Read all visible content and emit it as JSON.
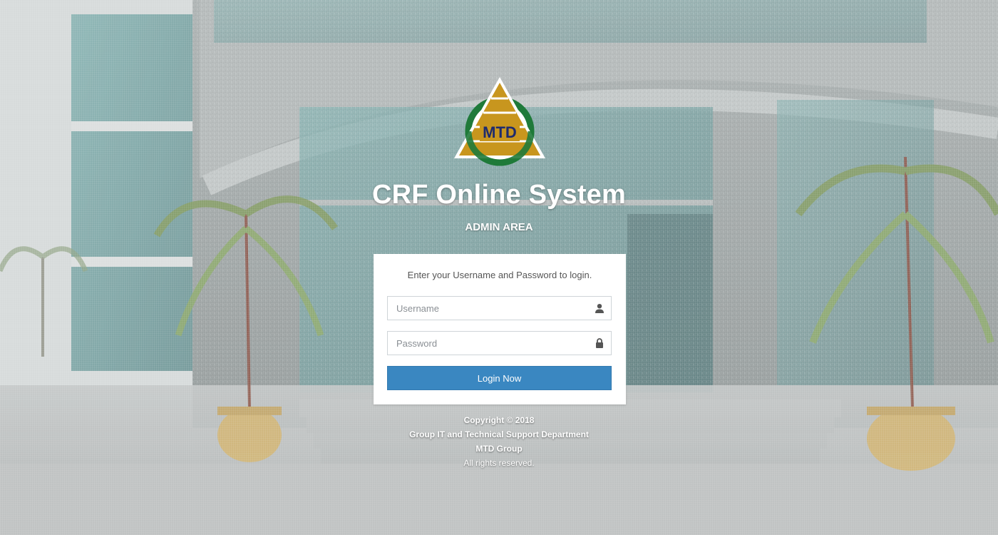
{
  "brand": {
    "logo_text": "MTD",
    "colors": {
      "gold": "#c8961e",
      "green": "#1f7a3a",
      "navy": "#1e2b6e",
      "accent": "#3a87c1"
    }
  },
  "header": {
    "title": "CRF Online System",
    "subtitle": "ADMIN AREA"
  },
  "login": {
    "instructions": "Enter your Username and Password to login.",
    "username": {
      "placeholder": "Username",
      "value": "",
      "icon": "user-icon"
    },
    "password": {
      "placeholder": "Password",
      "value": "",
      "icon": "lock-icon"
    },
    "submit_label": "Login Now"
  },
  "footer": {
    "copyright": "Copyright © 2018",
    "department": "Group IT and Technical Support Department",
    "company": "MTD Group",
    "rights": "All rights reserved."
  }
}
